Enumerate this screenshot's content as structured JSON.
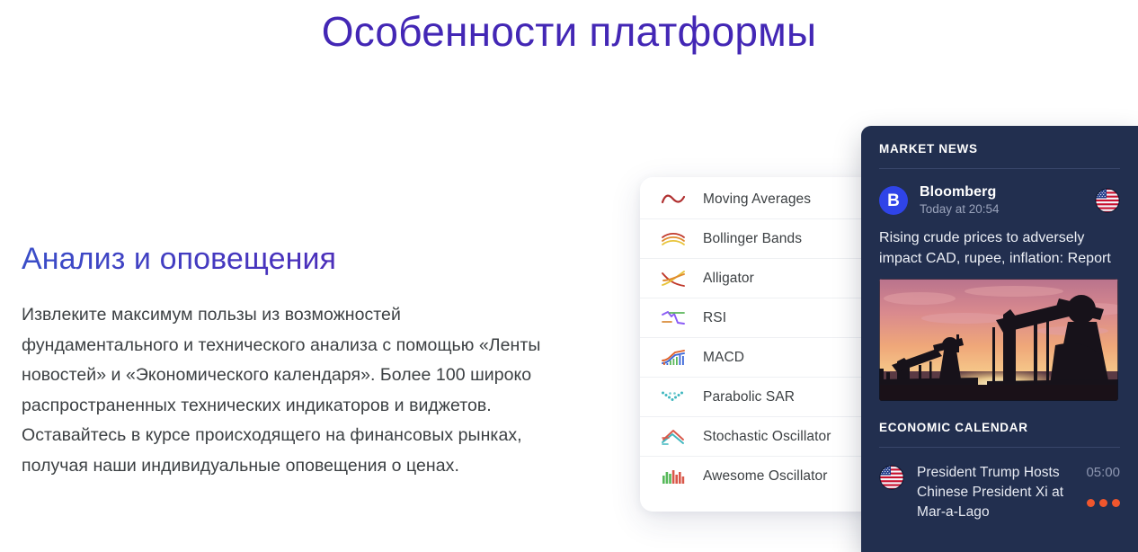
{
  "page": {
    "title": "Особенности платформы"
  },
  "feature": {
    "heading": "Анализ и оповещения",
    "body": "Извлеките максимум пользы из возможностей фундаментального и технического анализа с помощью «Ленты новостей» и «Экономического календаря». Более 100 широко распространенных технических индикаторов и виджетов. Оставайтесь в курсе происходящего на финансовых рынках, получая наши индивидуальные оповещения о ценах."
  },
  "indicators": {
    "items": [
      {
        "label": "Moving Averages",
        "icon": "moving-averages-icon"
      },
      {
        "label": "Bollinger Bands",
        "icon": "bollinger-bands-icon"
      },
      {
        "label": "Alligator",
        "icon": "alligator-icon"
      },
      {
        "label": "RSI",
        "icon": "rsi-icon"
      },
      {
        "label": "MACD",
        "icon": "macd-icon"
      },
      {
        "label": "Parabolic SAR",
        "icon": "parabolic-sar-icon"
      },
      {
        "label": "Stochastic Oscillator",
        "icon": "stochastic-oscillator-icon"
      },
      {
        "label": "Awesome Oscillator",
        "icon": "awesome-oscillator-icon"
      }
    ]
  },
  "news_panel": {
    "market_news_heading": "MARKET NEWS",
    "article": {
      "source": "Bloomberg",
      "source_badge_letter": "B",
      "timestamp": "Today at 20:54",
      "country_flag": "us-flag-icon",
      "headline": "Rising crude prices to adversely impact CAD, rupee, inflation: Report",
      "photo_alt": "oil-pumpjacks-at-sunset"
    },
    "economic_calendar_heading": "ECONOMIC CALENDAR",
    "calendar_events": [
      {
        "country_flag": "us-flag-icon",
        "title": "President Trump Hosts Chinese President Xi at Mar-a-Lago",
        "time": "05:00",
        "impact_dots": 3
      }
    ]
  },
  "colors": {
    "title_purple": "#4327b5",
    "heading_gradient_start": "#3a4ec8",
    "heading_gradient_end": "#5a20b0",
    "body_text": "#3c4043",
    "panel_bg": "#222f4f",
    "panel_rule": "#39466a",
    "bloomberg_blue": "#2f44e8",
    "impact_dot": "#f0562d",
    "muted_text": "#9aa3bb"
  }
}
